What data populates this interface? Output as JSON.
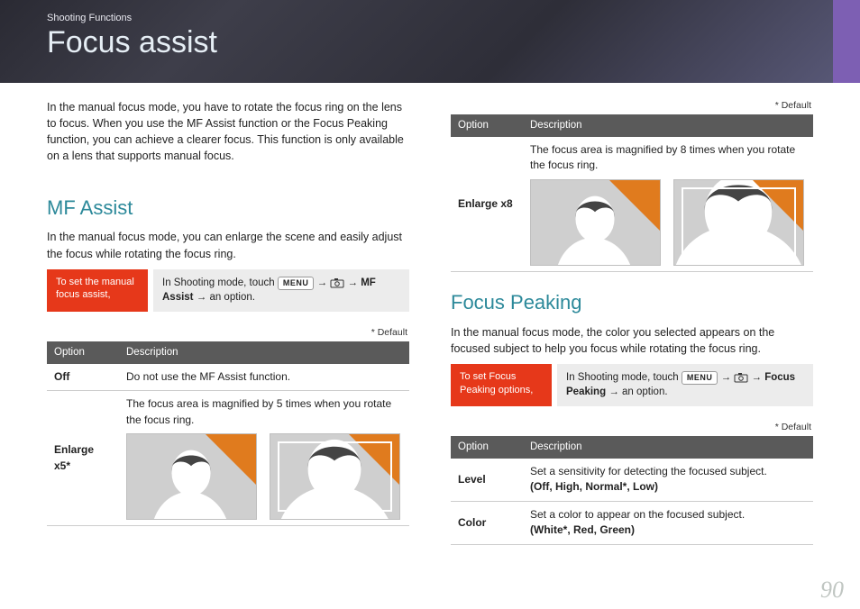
{
  "overline": "Shooting Functions",
  "title": "Focus assist",
  "intro": "In the manual focus mode, you have to rotate the focus ring on the lens to focus. When you use the MF Assist function or the Focus Peaking function, you can achieve a clearer focus. This function is only available on a lens that supports manual focus.",
  "mf": {
    "heading": "MF Assist",
    "text": "In the manual focus mode, you can enlarge the scene and easily adjust the focus while rotating the focus ring.",
    "red": "To set the manual focus assist,",
    "instr_prefix": "In Shooting mode, touch ",
    "menu": "MENU",
    "instr_bold": "MF Assist",
    "instr_suffix": "an option.",
    "default": "* Default",
    "th_option": "Option",
    "th_desc": "Description",
    "off": "Off",
    "off_desc": "Do not use the MF Assist function.",
    "x5": "Enlarge x5*",
    "x5_desc": "The focus area is magnified by 5 times when you rotate the focus ring.",
    "x8": "Enlarge x8",
    "x8_desc": "The focus area is magnified by 8 times when you rotate the focus ring."
  },
  "fp": {
    "heading": "Focus Peaking",
    "text": "In the manual focus mode, the color you selected appears on the focused subject to help you focus while rotating the focus ring.",
    "red": "To set Focus Peaking options,",
    "instr_prefix": "In Shooting mode, touch ",
    "menu": "MENU",
    "instr_bold": "Focus Peaking",
    "instr_suffix": "an option.",
    "default": "* Default",
    "th_option": "Option",
    "th_desc": "Description",
    "level": "Level",
    "level_desc": "Set a sensitivity for detecting the focused subject.",
    "level_opts": "(Off, High, Normal*, Low)",
    "color": "Color",
    "color_desc": "Set a color to appear on the focused subject.",
    "color_opts": "(White*, Red, Green)"
  },
  "arrow": "→",
  "pagenum": "90"
}
